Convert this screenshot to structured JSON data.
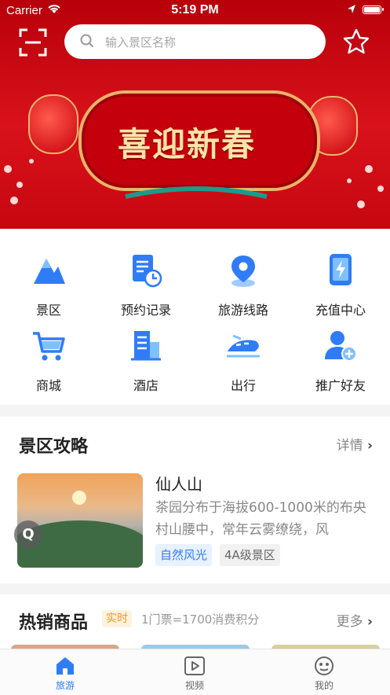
{
  "status_bar": {
    "carrier": "Carrier",
    "time": "5:19 PM",
    "battery_level": 1.0
  },
  "header": {
    "search_placeholder": "输入景区名称",
    "banner_text": "喜迎新春"
  },
  "menu": [
    {
      "label": "景区",
      "icon": "mountain-icon"
    },
    {
      "label": "预约记录",
      "icon": "document-clock-icon"
    },
    {
      "label": "旅游线路",
      "icon": "location-pin-icon"
    },
    {
      "label": "充值中心",
      "icon": "phone-bolt-icon"
    },
    {
      "label": "商城",
      "icon": "cart-icon"
    },
    {
      "label": "酒店",
      "icon": "building-icon"
    },
    {
      "label": "出行",
      "icon": "train-icon"
    },
    {
      "label": "推广好友",
      "icon": "add-user-icon"
    }
  ],
  "guide": {
    "title": "景区攻略",
    "more": "详情",
    "item": {
      "name": "仙人山",
      "description": "茶园分布于海拔600-1000米的布央村山腰中，常年云雾缭绕，风",
      "tags": [
        "自然风光",
        "4A级景区"
      ],
      "badge": "Q"
    }
  },
  "hot": {
    "title": "热销商品",
    "badge": "实时",
    "subtitle": "1门票=1700消费积分",
    "more": "更多"
  },
  "tabs": [
    {
      "label": "旅游",
      "active": true
    },
    {
      "label": "视频",
      "active": false
    },
    {
      "label": "我的",
      "active": false
    }
  ],
  "colors": {
    "accent": "#2f7cf6",
    "banner": "#d9121b",
    "tag_blue_bg": "#e8f1ff",
    "tag_gray_bg": "#f1f1f1",
    "badge_orange": "#f0961e"
  }
}
